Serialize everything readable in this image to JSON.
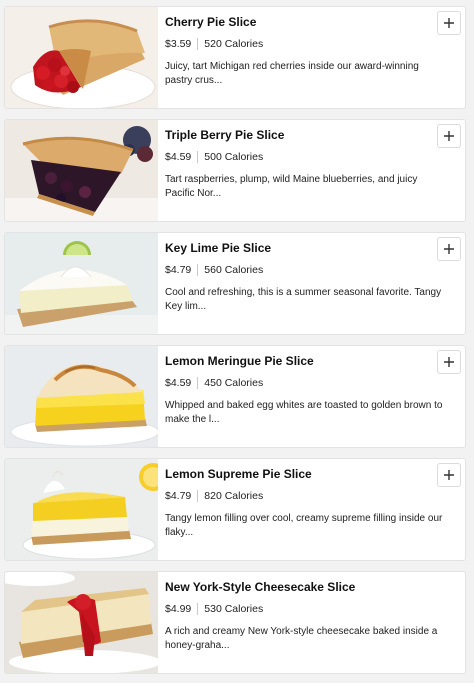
{
  "items": [
    {
      "name": "Cherry Pie Slice",
      "price": "$3.59",
      "calories": "520 Calories",
      "description": "Juicy, tart Michigan red cherries inside our award-winning pastry crus...",
      "image": "cherry-pie-slice-photo"
    },
    {
      "name": "Triple Berry Pie Slice",
      "price": "$4.59",
      "calories": "500 Calories",
      "description": "Tart raspberries, plump, wild Maine blueberries, and juicy Pacific Nor...",
      "image": "triple-berry-pie-slice-photo"
    },
    {
      "name": "Key Lime Pie Slice",
      "price": "$4.79",
      "calories": "560 Calories",
      "description": "Cool and refreshing, this is a summer seasonal favorite. Tangy Key lim...",
      "image": "key-lime-pie-slice-photo"
    },
    {
      "name": "Lemon Meringue Pie Slice",
      "price": "$4.59",
      "calories": "450 Calories",
      "description": "Whipped and baked egg whites are toasted to golden brown to make the l...",
      "image": "lemon-meringue-pie-slice-photo"
    },
    {
      "name": "Lemon Supreme Pie Slice",
      "price": "$4.79",
      "calories": "820 Calories",
      "description": "Tangy lemon filling over cool, creamy supreme filling inside our flaky...",
      "image": "lemon-supreme-pie-slice-photo"
    },
    {
      "name": "New York-Style Cheesecake Slice",
      "price": "$4.99",
      "calories": "530 Calories",
      "description": "A rich and creamy New York-style cheesecake baked inside a honey-graha...",
      "image": "new-york-cheesecake-slice-photo"
    }
  ],
  "add_icon": "plus-icon"
}
